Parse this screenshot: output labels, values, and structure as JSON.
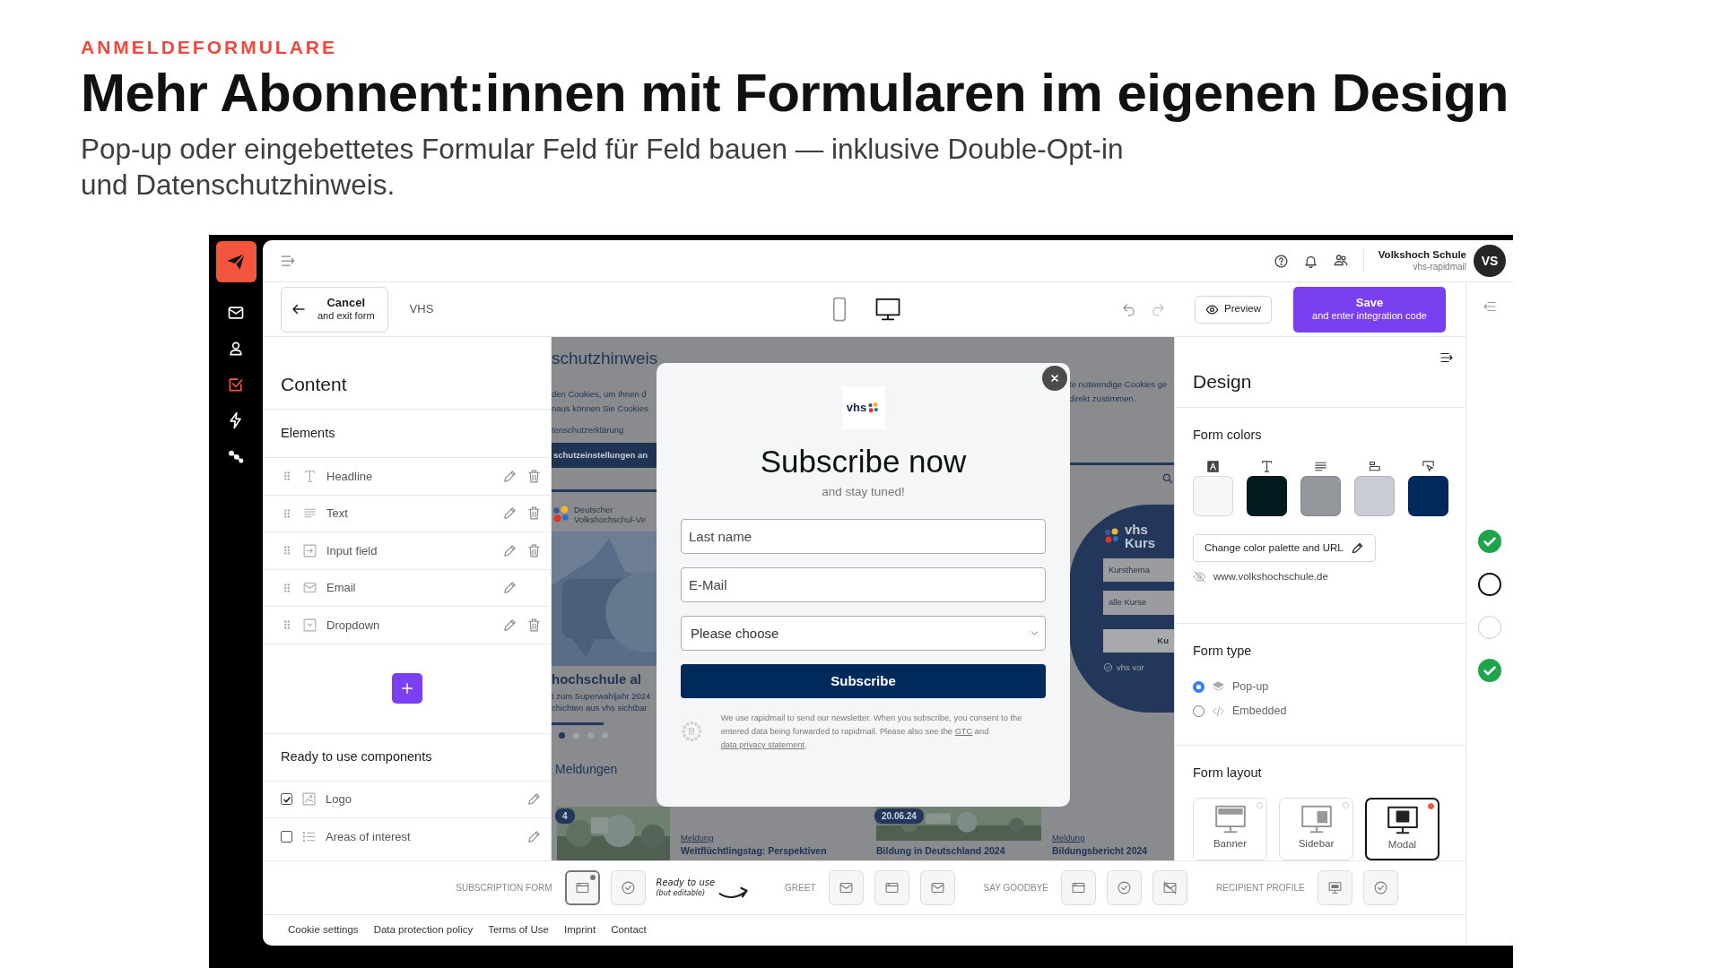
{
  "header": {
    "eyebrow": "ANMELDEFORMULARE",
    "title": "Mehr Abonnent:innen mit Formularen im eigenen Design",
    "subtitle": "Pop-up oder eingebettetes Formular Feld für Feld bauen — inklusive Double-Opt-in\nund Datenschutzhinweis."
  },
  "rail": {
    "items": [
      {
        "selected": false
      },
      {
        "selected": false
      },
      {
        "selected": true
      },
      {
        "selected": false
      },
      {
        "selected": false
      }
    ]
  },
  "topbar": {
    "account_name": "Volkshoch Schule",
    "account_sub": "vhs-rapidmail",
    "avatar": "VS"
  },
  "toolbar": {
    "cancel": "Cancel",
    "cancel_sub": "and exit form",
    "form_name": "VHS",
    "devices": [
      {
        "selected": false
      },
      {
        "selected": true
      }
    ],
    "preview": "Preview",
    "save": "Save",
    "save_sub": "and enter integration code"
  },
  "content": {
    "title": "Content",
    "elements_title": "Elements",
    "elements": [
      {
        "label": "Headline",
        "deletable": true
      },
      {
        "label": "Text",
        "deletable": true
      },
      {
        "label": "Input field",
        "deletable": true
      },
      {
        "label": "Email",
        "deletable": false
      },
      {
        "label": "Dropdown",
        "deletable": true
      }
    ],
    "components_title": "Ready to use components",
    "components": [
      {
        "label": "Logo",
        "checked": true
      },
      {
        "label": "Areas of interest",
        "checked": false
      }
    ]
  },
  "preview_site": {
    "heading": "schutzhinweis",
    "cookie_text_left": "den Cookies, um Ihnen d\nnaus können Sie Cookies",
    "privacy_link": "tenschutzerklärung",
    "settings_button": "schutzeinstellungen an",
    "cookie_text_right": "te notwendige Cookies ge\ndirekt zustimmen.",
    "brand": "Deutscher\nVolkshochschul-Ve",
    "hero_title": "hochschule al",
    "hero_text": "t zum Superwahljahr 2024\nchichten aus vhs sichtbar",
    "slides": [
      {
        "selected": true
      },
      {
        "selected": false
      },
      {
        "selected": false
      },
      {
        "selected": false
      }
    ],
    "news_heading": "Meldungen",
    "course_title": "vhs\nKurs",
    "course_fields": [
      "Kursthema",
      "alle Kurse"
    ],
    "course_button": "Ku",
    "course_link": "vhs vor",
    "news": [
      {
        "badge": "4"
      },
      {
        "kind": "text",
        "tag": "Meldung",
        "title": "Weltflüchtlingstag: Perspektiven"
      },
      {
        "badge": "20.06.24",
        "title": "Bildung in Deutschland 2024"
      },
      {
        "kind": "text",
        "tag": "Meldung",
        "title": "Bildungsbericht 2024"
      }
    ]
  },
  "modal": {
    "logo": "vhs",
    "headline": "Subscribe now",
    "subline": "and stay tuned!",
    "fields": [
      {
        "kind": "input",
        "placeholder": "Last name"
      },
      {
        "kind": "input",
        "placeholder": "E-Mail"
      },
      {
        "kind": "select",
        "value": "Please choose"
      }
    ],
    "button": "Subscribe",
    "notice": [
      {
        "text": "We use rapidmail to send our newsletter. When you subscribe, you consent to the entered data being forwarded to rapidmail. Please also see the ",
        "link": false
      },
      {
        "text": "GTC",
        "link": true
      },
      {
        "text": " and ",
        "link": false
      },
      {
        "text": "data privacy statement",
        "link": true
      },
      {
        "text": ".",
        "link": false
      }
    ]
  },
  "design": {
    "title": "Design",
    "colors_title": "Form colors",
    "swatches": [
      {
        "color": "#f5f6f8"
      },
      {
        "color": "#031a1e"
      },
      {
        "color": "#94979c"
      },
      {
        "color": "#c9ccd2"
      },
      {
        "color": "#002a5c"
      }
    ],
    "palette_button": "Change color palette and URL",
    "url": "www.volkshochschule.de",
    "type_title": "Form type",
    "types": [
      {
        "label": "Pop-up",
        "selected": true
      },
      {
        "label": "Embedded",
        "selected": false
      }
    ],
    "layout_title": "Form layout",
    "layouts": [
      {
        "label": "Banner",
        "selected": false
      },
      {
        "label": "Sidebar",
        "selected": false
      },
      {
        "label": "Modal",
        "selected": true
      }
    ]
  },
  "steps": [
    {
      "kind": "done"
    },
    {
      "kind": "current"
    },
    {
      "kind": "open"
    },
    {
      "kind": "done"
    }
  ],
  "bottom_bar": {
    "note": "Ready to use",
    "note_sub": "(but editable)",
    "groups": [
      {
        "label": "SUBSCRIPTION FORM",
        "buttons": [
          {
            "selected": true
          },
          {
            "selected": false
          }
        ]
      },
      {
        "label": "GREET",
        "buttons": [
          {
            "selected": false
          },
          {
            "selected": false
          },
          {
            "selected": false
          }
        ]
      },
      {
        "label": "SAY GOODBYE",
        "buttons": [
          {
            "selected": false
          },
          {
            "selected": false
          },
          {
            "selected": false
          }
        ]
      },
      {
        "label": "RECIPIENT PROFILE",
        "buttons": [
          {
            "selected": false
          },
          {
            "selected": false
          }
        ]
      }
    ]
  },
  "footer_links": [
    "Cookie settings",
    "Data protection policy",
    "Terms of Use",
    "Imprint",
    "Contact"
  ]
}
